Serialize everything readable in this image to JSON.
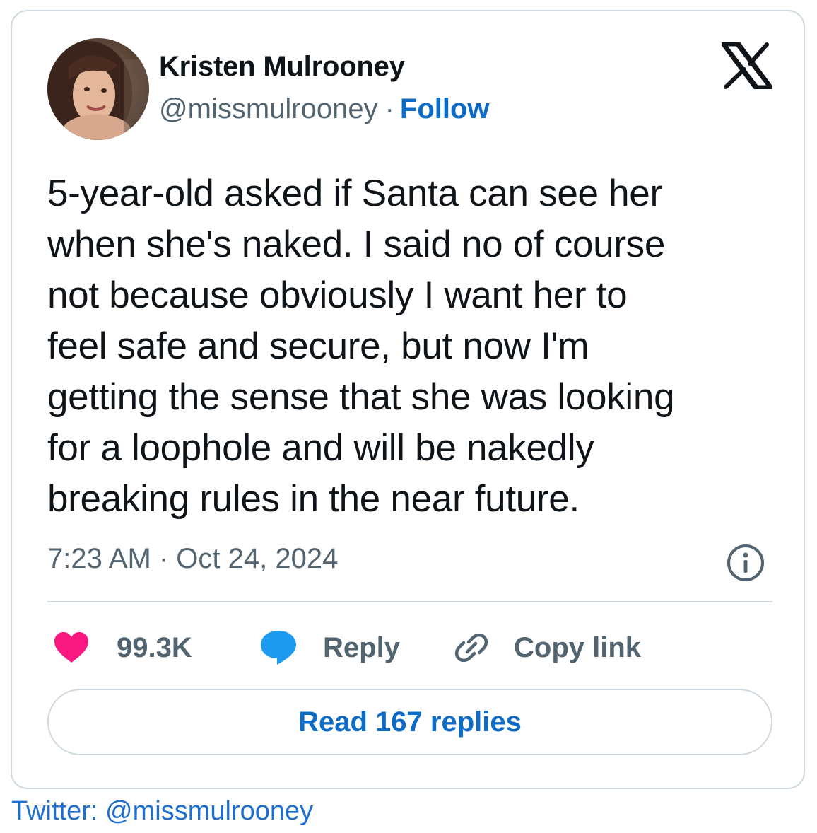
{
  "author": {
    "name": "Kristen Mulrooney",
    "handle": "@missmulrooney",
    "separator": "·",
    "follow_label": "Follow"
  },
  "tweet": {
    "lines": [
      "5-year-old asked if Santa can see her",
      "when she's naked. I said no of course",
      "not because obviously I want her to",
      "feel safe and secure, but now I'm",
      "getting the sense that she was looking",
      "for a loophole and will be nakedly",
      "breaking rules in the near future."
    ],
    "timestamp": "7:23 AM · Oct 24, 2024"
  },
  "actions": {
    "like_count": "99.3K",
    "reply_label": "Reply",
    "copy_label": "Copy link"
  },
  "read_replies_label": "Read 167 replies",
  "source_caption": "Twitter: @missmulrooney",
  "colors": {
    "like": "#f91880",
    "reply": "#1d9bf0",
    "link": "#0b6bc6",
    "muted": "#536471",
    "border": "#cfd9de"
  },
  "icons": [
    "x-logo-icon",
    "info-icon",
    "heart-icon",
    "speech-bubble-icon",
    "link-icon"
  ]
}
